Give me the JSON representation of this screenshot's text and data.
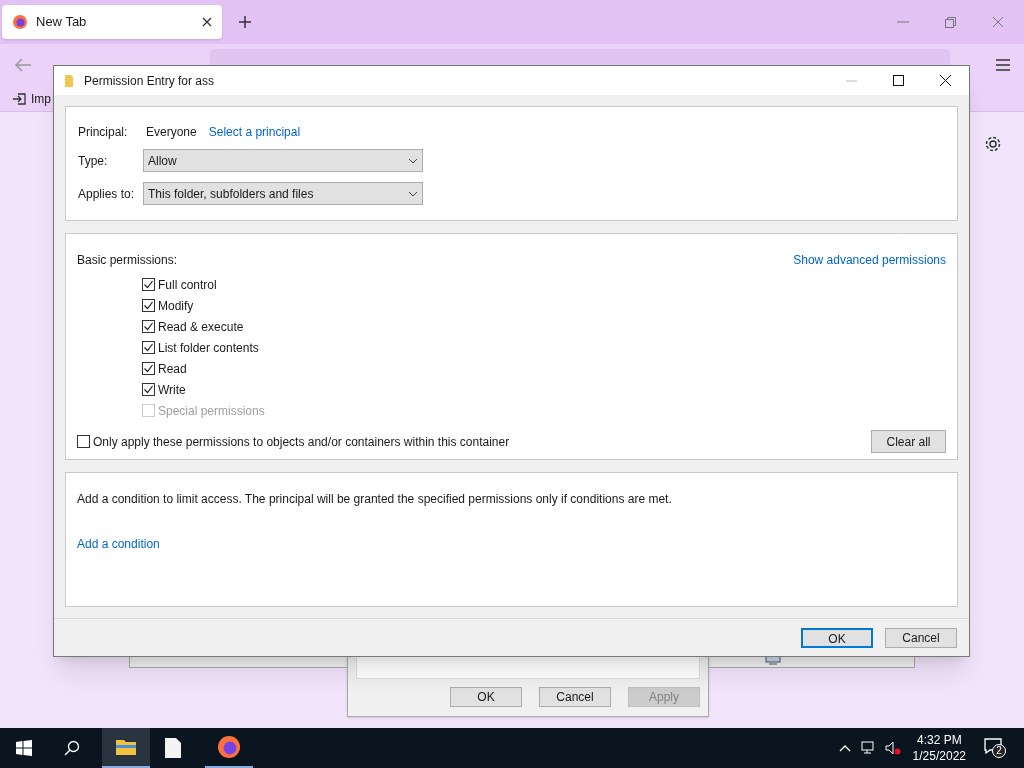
{
  "browser": {
    "tab": {
      "title": "New Tab",
      "selected": true
    },
    "bookmark": "Imp"
  },
  "behind": {
    "buttons": [
      {
        "label": "OK",
        "disabled": false
      },
      {
        "label": "Cancel",
        "disabled": false
      },
      {
        "label": "Apply",
        "disabled": true
      }
    ]
  },
  "dialog": {
    "title": "Permission Entry for ass",
    "principal": {
      "label": "Principal:",
      "value": "Everyone",
      "link": "Select a principal"
    },
    "type": {
      "label": "Type:",
      "value": "Allow"
    },
    "applies_to": {
      "label": "Applies to:",
      "value": "This folder, subfolders and files"
    },
    "basic_label": "Basic permissions:",
    "advanced_link": "Show advanced permissions",
    "permissions": [
      {
        "label": "Full control",
        "checked": true,
        "disabled": false
      },
      {
        "label": "Modify",
        "checked": true,
        "disabled": false
      },
      {
        "label": "Read & execute",
        "checked": true,
        "disabled": false
      },
      {
        "label": "List folder contents",
        "checked": true,
        "disabled": false
      },
      {
        "label": "Read",
        "checked": true,
        "disabled": false
      },
      {
        "label": "Write",
        "checked": true,
        "disabled": false
      },
      {
        "label": "Special permissions",
        "checked": false,
        "disabled": true
      }
    ],
    "only_apply": {
      "label": "Only apply these permissions to objects and/or containers within this container",
      "checked": false
    },
    "clear_all": "Clear all",
    "condition_text": "Add a condition to limit access. The principal will be granted the specified permissions only if conditions are met.",
    "condition_link": "Add a condition",
    "buttons": [
      {
        "label": "OK",
        "default": true
      },
      {
        "label": "Cancel",
        "default": false
      }
    ]
  },
  "taskbar": {
    "time": "4:32 PM",
    "date": "1/25/2022",
    "notifications": "2"
  }
}
